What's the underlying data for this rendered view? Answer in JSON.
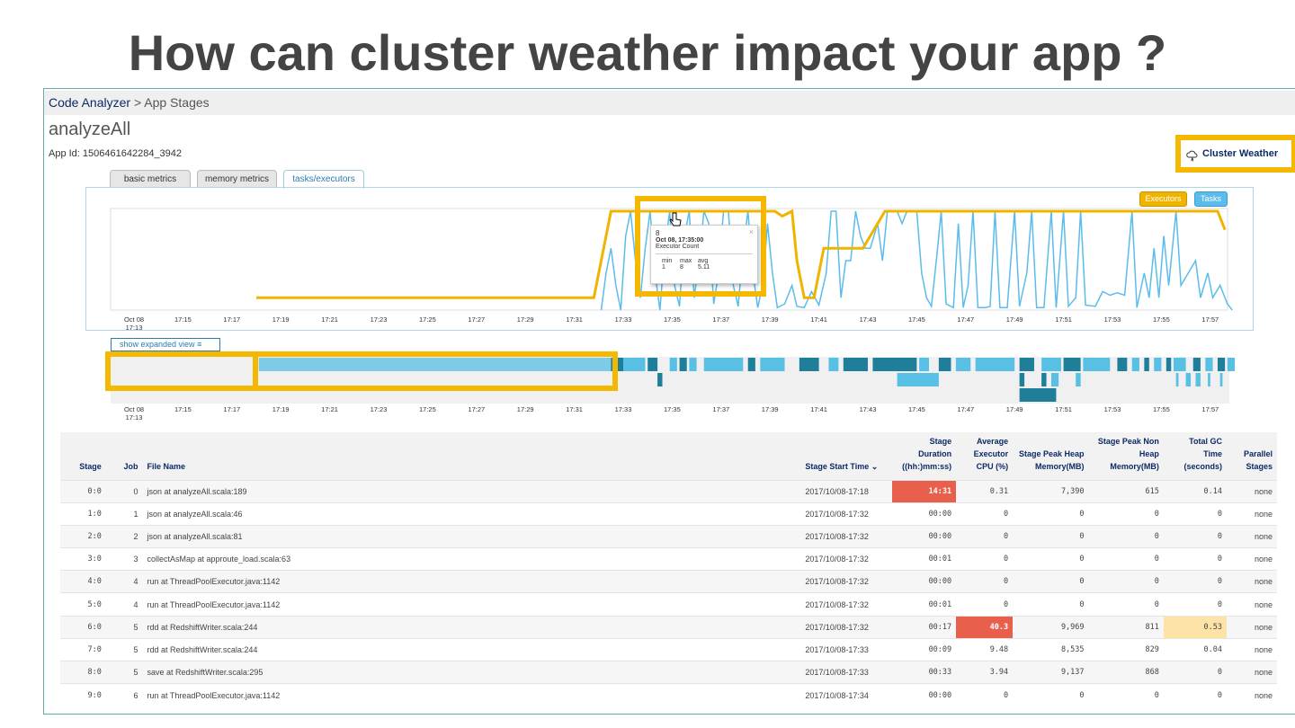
{
  "slide_title": "How can cluster weather impact your app ?",
  "breadcrumb": {
    "root": "Code Analyzer",
    "sep": " > ",
    "current": "App Stages"
  },
  "app": {
    "name": "analyzeAll",
    "id_label": "App Id: 1506461642284_3942"
  },
  "tabs": [
    {
      "label": "basic metrics"
    },
    {
      "label": "memory metrics"
    },
    {
      "label": "tasks/executors",
      "active": true
    }
  ],
  "cluster_weather_label": "Cluster Weather",
  "colors": {
    "executors": "#f0b400",
    "tasks": "#5bbcec",
    "highlight": "#f5b800",
    "red": "#e8604c",
    "yellow": "#fde3a6",
    "timeline_dark": "#1f7f9a",
    "timeline_light": "#58bfe5"
  },
  "chart_data": {
    "type": "line",
    "x_unit": "minutes after 17:13",
    "xlim": [
      0,
      45
    ],
    "ylim": [
      0,
      8.2
    ],
    "legend": [
      "Executors",
      "Tasks"
    ],
    "x_ticks": [
      {
        "t": 0,
        "label": "Oct 08",
        "label2": "17:13"
      },
      {
        "t": 2,
        "label": "17:15"
      },
      {
        "t": 4,
        "label": "17:17"
      },
      {
        "t": 6,
        "label": "17:19"
      },
      {
        "t": 8,
        "label": "17:21"
      },
      {
        "t": 10,
        "label": "17:23"
      },
      {
        "t": 12,
        "label": "17:25"
      },
      {
        "t": 14,
        "label": "17:27"
      },
      {
        "t": 16,
        "label": "17:29"
      },
      {
        "t": 18,
        "label": "17:31"
      },
      {
        "t": 20,
        "label": "17:33"
      },
      {
        "t": 22,
        "label": "17:35"
      },
      {
        "t": 24,
        "label": "17:37"
      },
      {
        "t": 26,
        "label": "17:39"
      },
      {
        "t": 28,
        "label": "17:41"
      },
      {
        "t": 30,
        "label": "17:43"
      },
      {
        "t": 32,
        "label": "17:45"
      },
      {
        "t": 34,
        "label": "17:47"
      },
      {
        "t": 36,
        "label": "17:49"
      },
      {
        "t": 38,
        "label": "17:51"
      },
      {
        "t": 40,
        "label": "17:53"
      },
      {
        "t": 42,
        "label": "17:55"
      },
      {
        "t": 44,
        "label": "17:57"
      }
    ],
    "series": [
      {
        "name": "Executors",
        "points": [
          [
            5,
            1
          ],
          [
            18.8,
            1
          ],
          [
            19.2,
            5
          ],
          [
            19.5,
            8
          ],
          [
            26.2,
            8
          ],
          [
            26.5,
            7.6
          ],
          [
            26.9,
            8
          ],
          [
            27.1,
            4
          ],
          [
            27.4,
            1
          ],
          [
            27.8,
            1
          ],
          [
            28.2,
            5
          ],
          [
            29.8,
            5
          ],
          [
            30.1,
            6
          ],
          [
            30.7,
            8
          ],
          [
            44.3,
            8
          ],
          [
            44.6,
            6.5
          ]
        ]
      },
      {
        "name": "Tasks",
        "points": [
          [
            19.1,
            0
          ],
          [
            19.3,
            3
          ],
          [
            19.5,
            5
          ],
          [
            19.7,
            2
          ],
          [
            19.9,
            0
          ],
          [
            20.1,
            6
          ],
          [
            20.3,
            8
          ],
          [
            20.5,
            4
          ],
          [
            20.7,
            1
          ],
          [
            20.9,
            5
          ],
          [
            21.1,
            8
          ],
          [
            21.3,
            3
          ],
          [
            21.5,
            0
          ],
          [
            21.7,
            5
          ],
          [
            21.9,
            8
          ],
          [
            22.1,
            2
          ],
          [
            22.3,
            0.3
          ],
          [
            22.5,
            6
          ],
          [
            22.7,
            8
          ],
          [
            22.9,
            1
          ],
          [
            23.1,
            4
          ],
          [
            23.3,
            8
          ],
          [
            23.5,
            7
          ],
          [
            23.7,
            0.5
          ],
          [
            23.9,
            3
          ],
          [
            24.1,
            8
          ],
          [
            24.3,
            8
          ],
          [
            24.5,
            2
          ],
          [
            24.7,
            0.3
          ],
          [
            24.9,
            5
          ],
          [
            25.1,
            8
          ],
          [
            25.3,
            3
          ],
          [
            25.5,
            0.2
          ],
          [
            25.7,
            2
          ],
          [
            25.9,
            7
          ],
          [
            26.1,
            3
          ],
          [
            26.3,
            0.2
          ],
          [
            26.6,
            0.5
          ],
          [
            26.9,
            2
          ],
          [
            27.1,
            0.3
          ],
          [
            27.4,
            0.2
          ],
          [
            27.7,
            1.5
          ],
          [
            28.0,
            0.4
          ],
          [
            28.3,
            3
          ],
          [
            28.5,
            8
          ],
          [
            28.7,
            8
          ],
          [
            28.9,
            1
          ],
          [
            29.1,
            4
          ],
          [
            29.3,
            4
          ],
          [
            29.5,
            8
          ],
          [
            29.7,
            6
          ],
          [
            29.9,
            5
          ],
          [
            30.1,
            5
          ],
          [
            30.4,
            7
          ],
          [
            30.6,
            4
          ],
          [
            30.8,
            8
          ],
          [
            31.2,
            8
          ],
          [
            31.4,
            7
          ],
          [
            31.6,
            8
          ],
          [
            32.0,
            8
          ],
          [
            32.2,
            3
          ],
          [
            32.4,
            1
          ],
          [
            32.6,
            0.3
          ],
          [
            32.8,
            4
          ],
          [
            33.0,
            8
          ],
          [
            33.2,
            0.5
          ],
          [
            33.5,
            0.2
          ],
          [
            33.7,
            7
          ],
          [
            33.9,
            0.2
          ],
          [
            34.1,
            2
          ],
          [
            34.3,
            8
          ],
          [
            34.5,
            0.2
          ],
          [
            34.8,
            0.2
          ],
          [
            35.0,
            0.3
          ],
          [
            35.2,
            8
          ],
          [
            35.4,
            0.2
          ],
          [
            35.7,
            0.2
          ],
          [
            36.0,
            8
          ],
          [
            36.2,
            0.3
          ],
          [
            36.5,
            3
          ],
          [
            36.7,
            8
          ],
          [
            36.9,
            0.2
          ],
          [
            37.2,
            0.2
          ],
          [
            37.5,
            8
          ],
          [
            37.7,
            0.2
          ],
          [
            38.0,
            8
          ],
          [
            38.2,
            0.3
          ],
          [
            38.5,
            1
          ],
          [
            38.7,
            8
          ],
          [
            38.9,
            0.4
          ],
          [
            39.3,
            0.3
          ],
          [
            39.6,
            1.5
          ],
          [
            39.9,
            1.2
          ],
          [
            40.2,
            1.4
          ],
          [
            40.5,
            1.2
          ],
          [
            40.8,
            8
          ],
          [
            41.0,
            0.2
          ],
          [
            41.3,
            3
          ],
          [
            41.5,
            1
          ],
          [
            41.7,
            5
          ],
          [
            41.9,
            1
          ],
          [
            42.1,
            6
          ],
          [
            42.3,
            2
          ],
          [
            42.6,
            8
          ],
          [
            42.8,
            2
          ],
          [
            43.1,
            3
          ],
          [
            43.4,
            4
          ],
          [
            43.6,
            1
          ],
          [
            43.9,
            3
          ],
          [
            44.1,
            1
          ],
          [
            44.4,
            2
          ],
          [
            44.7,
            0.5
          ],
          [
            44.9,
            0
          ]
        ]
      }
    ]
  },
  "tooltip": {
    "value": "8",
    "time": "Oct 08, 17:35:00",
    "metric": "Executor Count",
    "stats_headers": [
      "min",
      "max",
      "avg"
    ],
    "stats": [
      "1",
      "8",
      "5.11"
    ]
  },
  "expanded_view_label": "show expanded view",
  "timeline": {
    "rows": [
      [
        [
          5.1,
          19.5,
          "light"
        ],
        [
          19.5,
          20.0,
          "dark"
        ],
        [
          20.0,
          20.9,
          "light"
        ],
        [
          21.0,
          21.4,
          "dark"
        ],
        [
          21.9,
          22.2,
          "light"
        ],
        [
          22.3,
          22.6,
          "dark"
        ],
        [
          22.7,
          23.0,
          "light"
        ],
        [
          23.3,
          24.9,
          "light"
        ],
        [
          25.1,
          25.4,
          "dark"
        ],
        [
          25.6,
          26.6,
          "light"
        ],
        [
          27.2,
          28.0,
          "dark"
        ],
        [
          28.4,
          28.8,
          "light"
        ],
        [
          29.0,
          30.0,
          "dark"
        ],
        [
          30.2,
          32.0,
          "dark"
        ],
        [
          32.1,
          32.5,
          "light"
        ],
        [
          32.9,
          33.4,
          "dark"
        ],
        [
          33.6,
          34.2,
          "light"
        ],
        [
          34.4,
          36.0,
          "light"
        ],
        [
          36.2,
          36.8,
          "dark"
        ],
        [
          37.1,
          37.9,
          "light"
        ],
        [
          38.0,
          38.7,
          "dark"
        ],
        [
          38.8,
          39.9,
          "light"
        ],
        [
          40.2,
          40.6,
          "dark"
        ],
        [
          40.8,
          41.1,
          "light"
        ],
        [
          41.3,
          41.5,
          "dark"
        ],
        [
          41.7,
          42.0,
          "light"
        ],
        [
          42.2,
          42.4,
          "dark"
        ],
        [
          42.5,
          43.0,
          "light"
        ],
        [
          43.3,
          43.6,
          "dark"
        ],
        [
          43.8,
          44.1,
          "light"
        ],
        [
          44.3,
          44.6,
          "dark"
        ],
        [
          44.7,
          45,
          "light"
        ]
      ],
      [
        [
          21.4,
          21.6,
          "dark"
        ],
        [
          31.2,
          32.9,
          "light"
        ],
        [
          36.2,
          36.4,
          "dark"
        ],
        [
          37.1,
          37.3,
          "dark"
        ],
        [
          37.5,
          37.8,
          "light"
        ],
        [
          38.5,
          38.7,
          "light"
        ],
        [
          42.6,
          42.7,
          "light"
        ],
        [
          43.0,
          43.2,
          "light"
        ],
        [
          43.4,
          43.6,
          "light"
        ],
        [
          43.9,
          44.0,
          "light"
        ],
        [
          44.4,
          44.5,
          "light"
        ]
      ],
      [
        [
          36.2,
          37.7,
          "dark"
        ]
      ]
    ]
  },
  "table": {
    "headers": [
      "Stage",
      "Job",
      "File Name",
      "Stage Start Time",
      "Stage Duration ((hh:)mm:ss)",
      "Average Executor CPU (%)",
      "Stage Peak Heap Memory(MB)",
      "Stage Peak Non Heap Memory(MB)",
      "Total GC Time (seconds)",
      "Parallel Stages"
    ],
    "rows": [
      [
        "0:0",
        "0",
        "json at analyzeAll.scala:189",
        "2017/10/08-17:18",
        "14:31",
        "0.31",
        "7,390",
        "615",
        "0.14",
        "none"
      ],
      [
        "1:0",
        "1",
        "json at analyzeAll.scala:46",
        "2017/10/08-17:32",
        "00:00",
        "0",
        "0",
        "0",
        "0",
        "none"
      ],
      [
        "2:0",
        "2",
        "json at analyzeAll.scala:81",
        "2017/10/08-17:32",
        "00:00",
        "0",
        "0",
        "0",
        "0",
        "none"
      ],
      [
        "3:0",
        "3",
        "collectAsMap at approute_load.scala:63",
        "2017/10/08-17:32",
        "00:01",
        "0",
        "0",
        "0",
        "0",
        "none"
      ],
      [
        "4:0",
        "4",
        "run at ThreadPoolExecutor.java:1142",
        "2017/10/08-17:32",
        "00:00",
        "0",
        "0",
        "0",
        "0",
        "none"
      ],
      [
        "5:0",
        "4",
        "run at ThreadPoolExecutor.java:1142",
        "2017/10/08-17:32",
        "00:01",
        "0",
        "0",
        "0",
        "0",
        "none"
      ],
      [
        "6:0",
        "5",
        "rdd at RedshiftWriter.scala:244",
        "2017/10/08-17:32",
        "00:17",
        "40.3",
        "9,969",
        "811",
        "0.53",
        "none"
      ],
      [
        "7:0",
        "5",
        "rdd at RedshiftWriter.scala:244",
        "2017/10/08-17:33",
        "00:09",
        "9.48",
        "8,535",
        "829",
        "0.04",
        "none"
      ],
      [
        "8:0",
        "5",
        "save at RedshiftWriter.scala:295",
        "2017/10/08-17:33",
        "00:33",
        "3.94",
        "9,137",
        "868",
        "0",
        "none"
      ],
      [
        "9:0",
        "6",
        "run at ThreadPoolExecutor.java:1142",
        "2017/10/08-17:34",
        "00:00",
        "0",
        "0",
        "0",
        "0",
        "none"
      ]
    ],
    "highlights": [
      {
        "row": 0,
        "col": 4,
        "level": "red"
      },
      {
        "row": 6,
        "col": 5,
        "level": "red"
      },
      {
        "row": 6,
        "col": 8,
        "level": "yellow"
      }
    ]
  }
}
